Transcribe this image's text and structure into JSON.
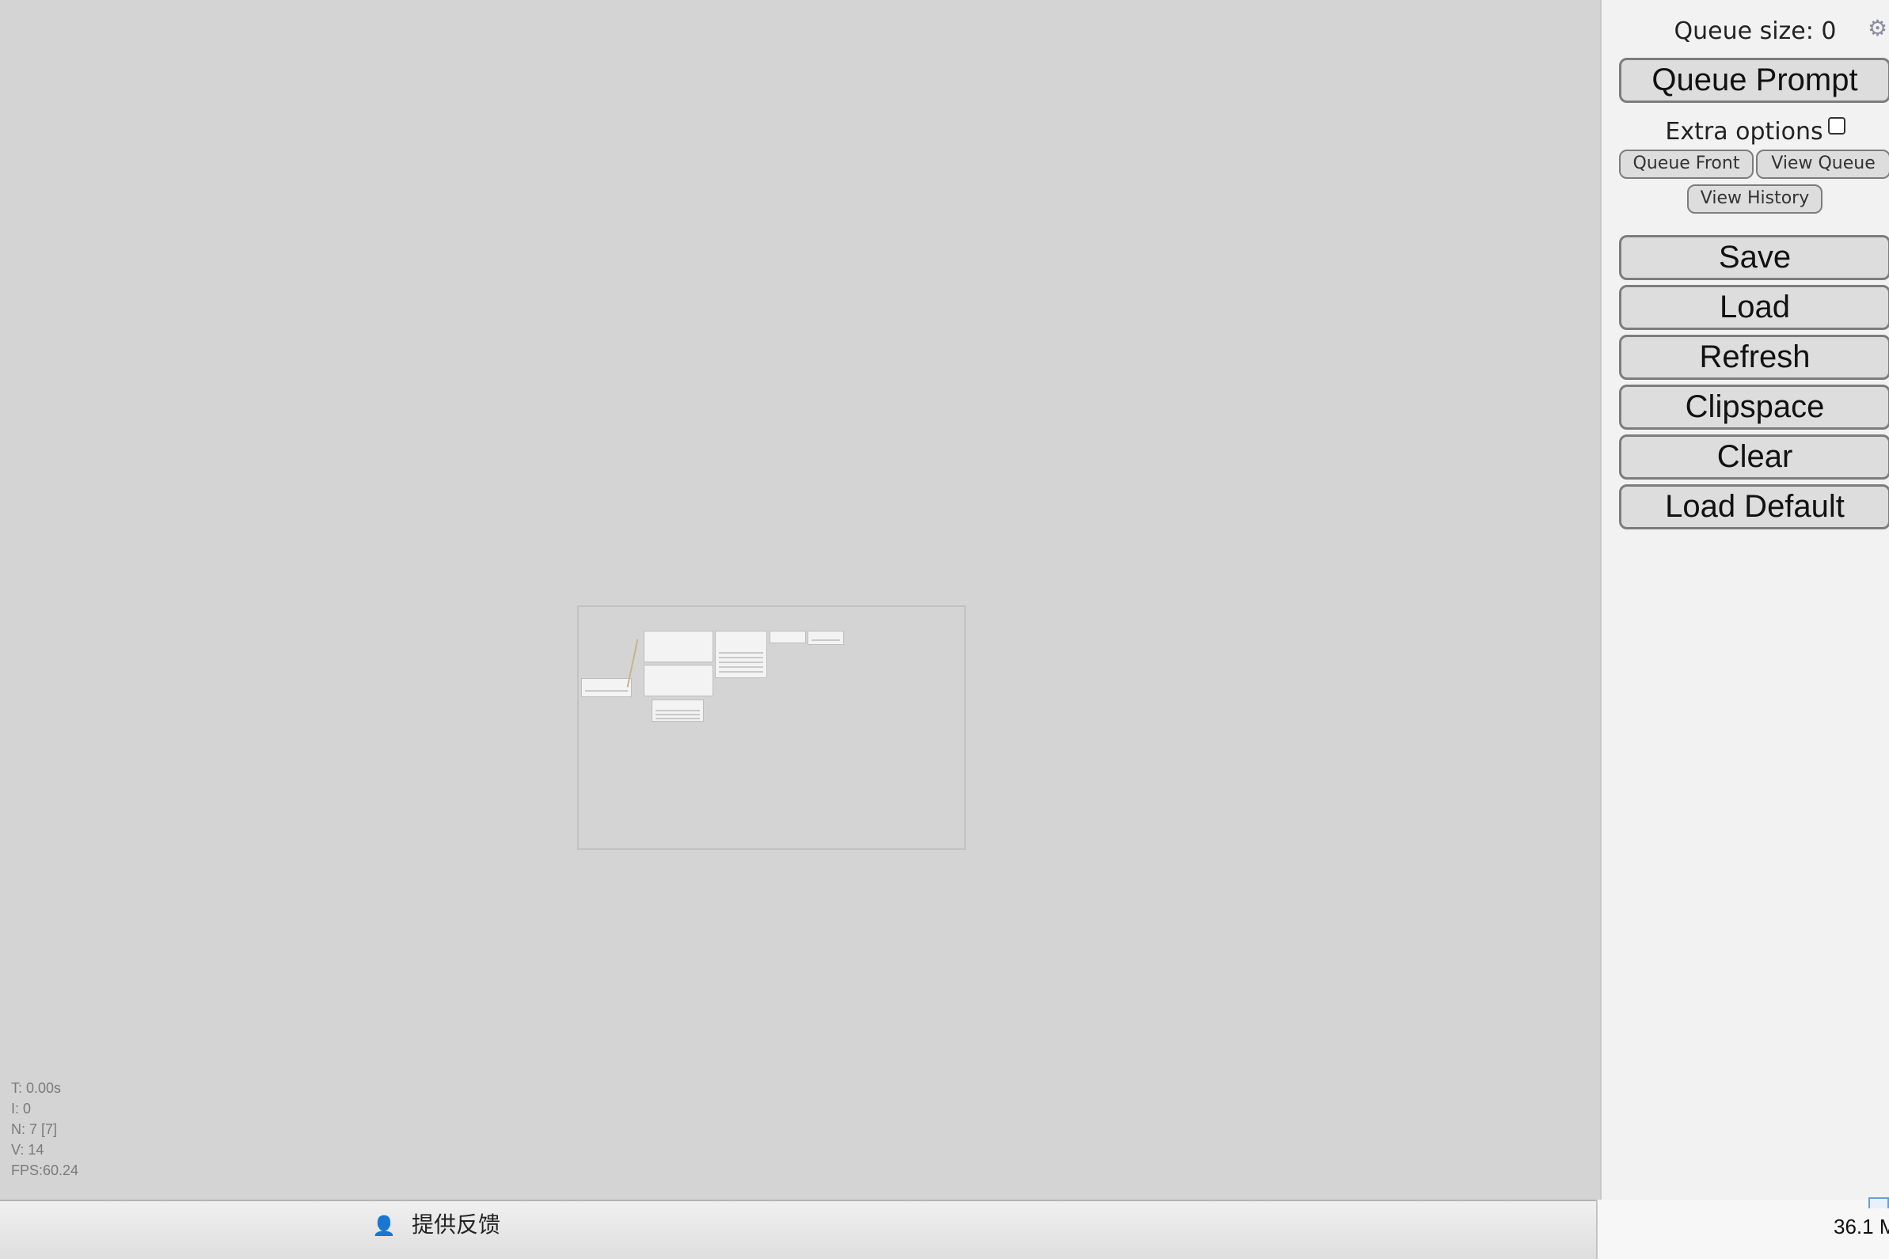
{
  "menu": {
    "queue_size": "Queue size: 0",
    "settings_icon": "gear-icon",
    "queue_prompt": "Queue Prompt",
    "extra_options": "Extra options",
    "extra_options_checked": false,
    "queue_front": "Queue Front",
    "view_queue": "View Queue",
    "view_history": "View History",
    "save": "Save",
    "load": "Load",
    "refresh": "Refresh",
    "clipspace": "Clipspace",
    "clear": "Clear",
    "load_default": "Load Default"
  },
  "stats": {
    "t": "T: 0.00s",
    "i": "I: 0",
    "n": "N: 7 [7]",
    "v": "V: 14",
    "fps": "FPS:60.24"
  },
  "taskbar": {
    "feedback_label": "提供反馈",
    "feedback_icon": "feedback-person-icon",
    "memory": "36.1 M"
  },
  "colors": {
    "canvas_bg": "#d4d4d4",
    "menu_bg": "#f2f2f2",
    "button_bg": "#dddddd",
    "button_border": "#7d7d7d"
  }
}
